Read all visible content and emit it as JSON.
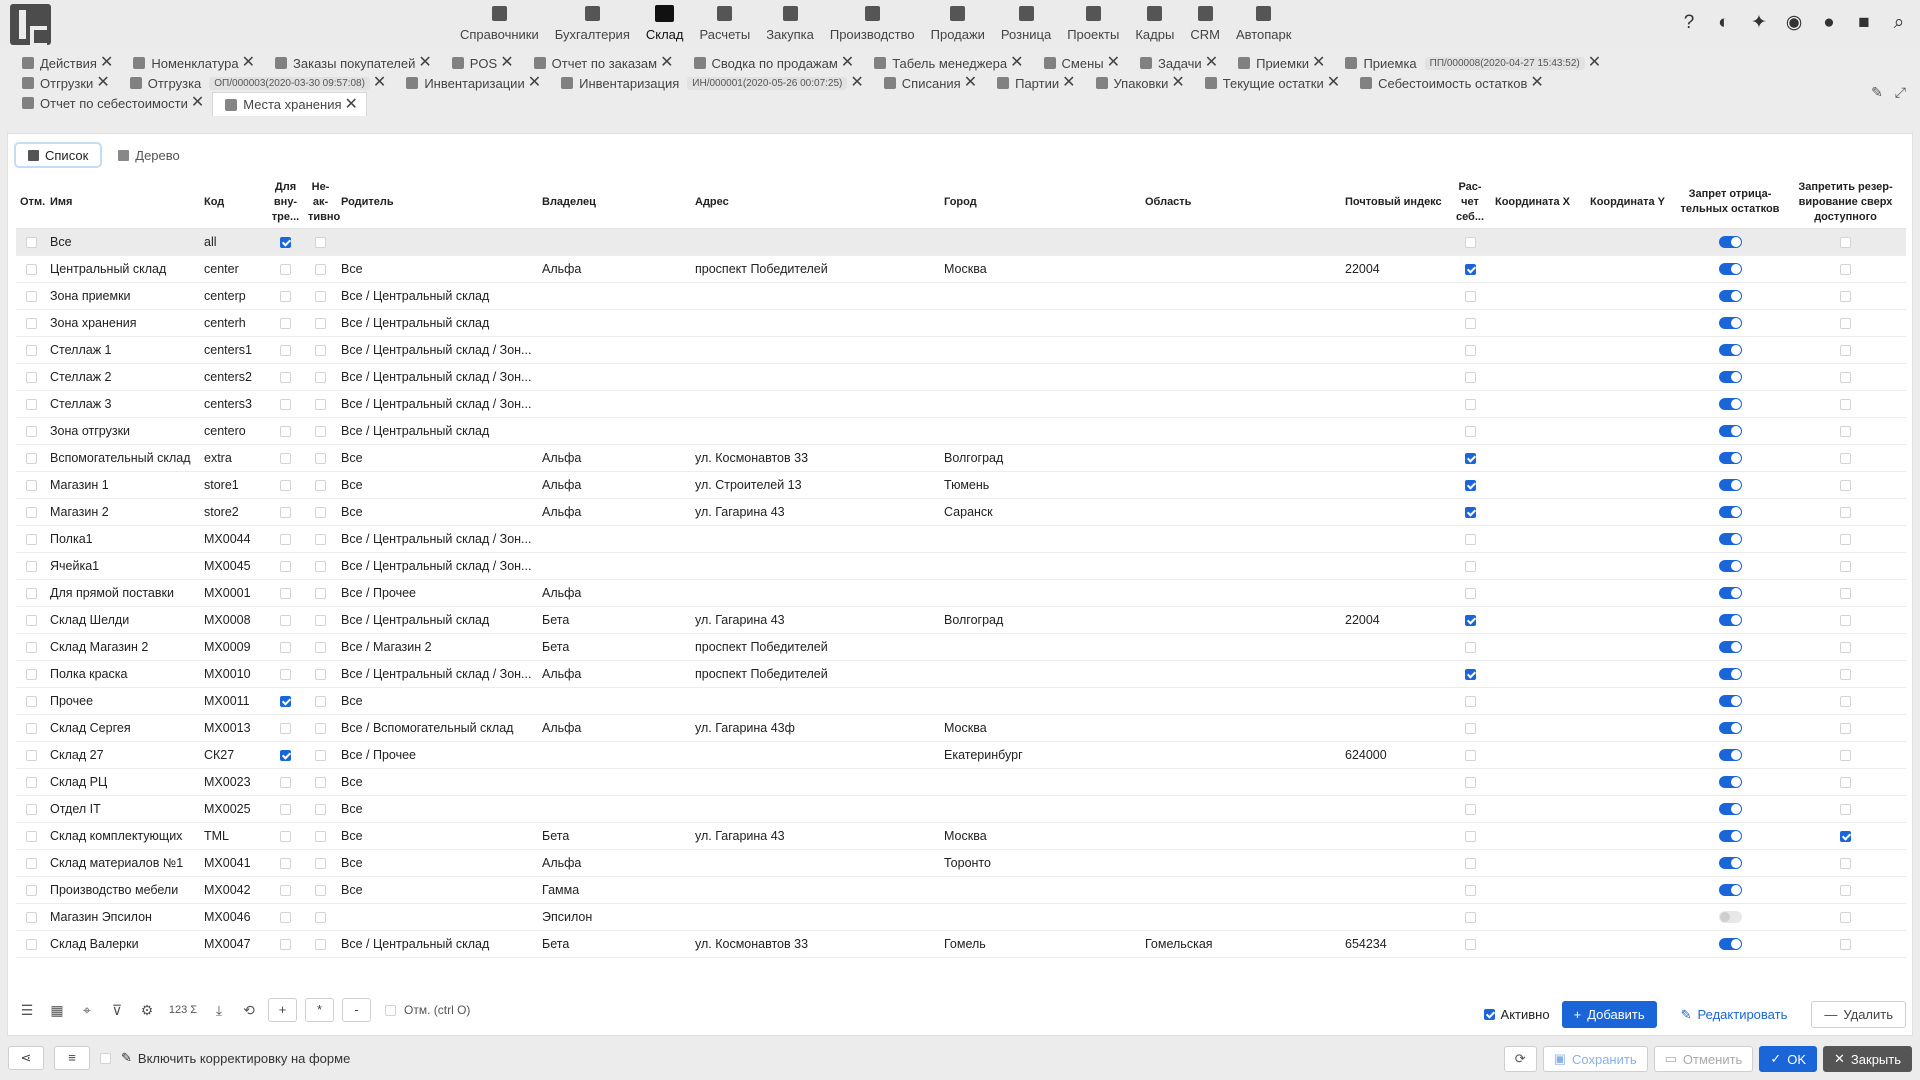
{
  "menu": [
    {
      "label": "Справочники",
      "icon": "list-icon"
    },
    {
      "label": "Бухгалтерия",
      "icon": "ledger-icon"
    },
    {
      "label": "Склад",
      "icon": "warehouse-icon",
      "active": true
    },
    {
      "label": "Расчеты",
      "icon": "money-icon"
    },
    {
      "label": "Закупка",
      "icon": "cart-icon"
    },
    {
      "label": "Производство",
      "icon": "factory-icon"
    },
    {
      "label": "Продажи",
      "icon": "sale-icon"
    },
    {
      "label": "Розница",
      "icon": "bag-icon"
    },
    {
      "label": "Проекты",
      "icon": "project-icon"
    },
    {
      "label": "Кадры",
      "icon": "fingerprint-icon"
    },
    {
      "label": "CRM",
      "icon": "crm-icon"
    },
    {
      "label": "Автопарк",
      "icon": "bus-icon"
    }
  ],
  "top_icons": [
    {
      "name": "help-icon",
      "glyph": "?"
    },
    {
      "name": "contrast-icon",
      "glyph": "◐"
    },
    {
      "name": "pin-icon",
      "glyph": "✦"
    },
    {
      "name": "eye-icon",
      "glyph": "◉"
    },
    {
      "name": "chat-icon",
      "glyph": "●"
    },
    {
      "name": "lock-icon",
      "glyph": "■"
    },
    {
      "name": "search-icon",
      "glyph": "⌕"
    }
  ],
  "tabs_row1": [
    {
      "label": "Действия"
    },
    {
      "label": "Номенклатура"
    },
    {
      "label": "Заказы покупателей"
    },
    {
      "label": "POS"
    },
    {
      "label": "Отчет по заказам"
    },
    {
      "label": "Сводка по продажам"
    },
    {
      "label": "Табель менеджера"
    },
    {
      "label": "Смены"
    },
    {
      "label": "Задачи"
    },
    {
      "label": "Приемки"
    },
    {
      "label": "Приемка",
      "tag": "ПП/000008(2020-04-27 15:43:52)"
    }
  ],
  "tabs_row2": [
    {
      "label": "Отгрузки"
    },
    {
      "label": "Отгрузка",
      "tag": "ОП/000003(2020-03-30 09:57:08)"
    },
    {
      "label": "Инвентаризации"
    },
    {
      "label": "Инвентаризация",
      "tag": "ИН/000001(2020-05-26 00:07:25)"
    },
    {
      "label": "Списания"
    },
    {
      "label": "Партии"
    },
    {
      "label": "Упаковки"
    },
    {
      "label": "Текущие остатки"
    },
    {
      "label": "Себестоимость остатков"
    }
  ],
  "tabs_row3": [
    {
      "label": "Отчет по себестоимости"
    },
    {
      "label": "Места хранения",
      "active": true
    }
  ],
  "view_tabs": {
    "list": "Список",
    "tree": "Дерево"
  },
  "columns": [
    "Отм.",
    "Имя",
    "Код",
    "Для вну-тре...",
    "Не-ак-тивно",
    "Родитель",
    "Владелец",
    "Адрес",
    "Город",
    "Область",
    "Почтовый индекс",
    "Рас-чет себ...",
    "Координата X",
    "Координата Y",
    "Запрет отрица-тельных остатков",
    "Запретить резер-вирование сверх доступного"
  ],
  "rows": [
    {
      "name": "Все",
      "code": "all",
      "internal": true,
      "inactive": false,
      "parent": "",
      "owner": "",
      "address": "",
      "city": "",
      "region": "",
      "zip": "",
      "cost": false,
      "x": "",
      "y": "",
      "neg": true,
      "reserve": false,
      "selected": true
    },
    {
      "name": "Центральный склад",
      "code": "center",
      "internal": false,
      "inactive": false,
      "parent": "Все",
      "owner": "Альфа",
      "address": "проспект Победителей",
      "city": "Москва",
      "region": "",
      "zip": "22004",
      "cost": true,
      "x": "",
      "y": "",
      "neg": true,
      "reserve": false
    },
    {
      "name": "Зона приемки",
      "code": "centerp",
      "internal": false,
      "inactive": false,
      "parent": "Все / Центральный склад",
      "owner": "",
      "address": "",
      "city": "",
      "region": "",
      "zip": "",
      "cost": false,
      "x": "",
      "y": "",
      "neg": true,
      "reserve": false
    },
    {
      "name": "Зона хранения",
      "code": "centerh",
      "internal": false,
      "inactive": false,
      "parent": "Все / Центральный склад",
      "owner": "",
      "address": "",
      "city": "",
      "region": "",
      "zip": "",
      "cost": false,
      "x": "",
      "y": "",
      "neg": true,
      "reserve": false
    },
    {
      "name": "Стеллаж 1",
      "code": "centers1",
      "internal": false,
      "inactive": false,
      "parent": "Все / Центральный склад / Зон...",
      "owner": "",
      "address": "",
      "city": "",
      "region": "",
      "zip": "",
      "cost": false,
      "x": "",
      "y": "",
      "neg": true,
      "reserve": false
    },
    {
      "name": "Стеллаж 2",
      "code": "centers2",
      "internal": false,
      "inactive": false,
      "parent": "Все / Центральный склад / Зон...",
      "owner": "",
      "address": "",
      "city": "",
      "region": "",
      "zip": "",
      "cost": false,
      "x": "",
      "y": "",
      "neg": true,
      "reserve": false
    },
    {
      "name": "Стеллаж 3",
      "code": "centers3",
      "internal": false,
      "inactive": false,
      "parent": "Все / Центральный склад / Зон...",
      "owner": "",
      "address": "",
      "city": "",
      "region": "",
      "zip": "",
      "cost": false,
      "x": "",
      "y": "",
      "neg": true,
      "reserve": false
    },
    {
      "name": "Зона отгрузки",
      "code": "centero",
      "internal": false,
      "inactive": false,
      "parent": "Все / Центральный склад",
      "owner": "",
      "address": "",
      "city": "",
      "region": "",
      "zip": "",
      "cost": false,
      "x": "",
      "y": "",
      "neg": true,
      "reserve": false
    },
    {
      "name": "Вспомогательный склад",
      "code": "extra",
      "internal": false,
      "inactive": false,
      "parent": "Все",
      "owner": "Альфа",
      "address": "ул. Космонавтов 33",
      "city": "Волгоград",
      "region": "",
      "zip": "",
      "cost": true,
      "x": "",
      "y": "",
      "neg": true,
      "reserve": false
    },
    {
      "name": "Магазин 1",
      "code": "store1",
      "internal": false,
      "inactive": false,
      "parent": "Все",
      "owner": "Альфа",
      "address": "ул. Строителей 13",
      "city": "Тюмень",
      "region": "",
      "zip": "",
      "cost": true,
      "x": "",
      "y": "",
      "neg": true,
      "reserve": false
    },
    {
      "name": "Магазин 2",
      "code": "store2",
      "internal": false,
      "inactive": false,
      "parent": "Все",
      "owner": "Альфа",
      "address": "ул. Гагарина 43",
      "city": "Саранск",
      "region": "",
      "zip": "",
      "cost": true,
      "x": "",
      "y": "",
      "neg": true,
      "reserve": false
    },
    {
      "name": "Полка1",
      "code": "MX0044",
      "internal": false,
      "inactive": false,
      "parent": "Все / Центральный склад / Зон...",
      "owner": "",
      "address": "",
      "city": "",
      "region": "",
      "zip": "",
      "cost": false,
      "x": "",
      "y": "",
      "neg": true,
      "reserve": false
    },
    {
      "name": "Ячейка1",
      "code": "MX0045",
      "internal": false,
      "inactive": false,
      "parent": "Все / Центральный склад / Зон...",
      "owner": "",
      "address": "",
      "city": "",
      "region": "",
      "zip": "",
      "cost": false,
      "x": "",
      "y": "",
      "neg": true,
      "reserve": false
    },
    {
      "name": "Для прямой поставки",
      "code": "MX0001",
      "internal": false,
      "inactive": false,
      "parent": "Все / Прочее",
      "owner": "Альфа",
      "address": "",
      "city": "",
      "region": "",
      "zip": "",
      "cost": false,
      "x": "",
      "y": "",
      "neg": true,
      "reserve": false
    },
    {
      "name": "Склад Шелди",
      "code": "MX0008",
      "internal": false,
      "inactive": false,
      "parent": "Все / Центральный склад",
      "owner": "Бета",
      "address": "ул. Гагарина 43",
      "city": "Волгоград",
      "region": "",
      "zip": "22004",
      "cost": true,
      "x": "",
      "y": "",
      "neg": true,
      "reserve": false
    },
    {
      "name": "Склад Магазин 2",
      "code": "MX0009",
      "internal": false,
      "inactive": false,
      "parent": "Все / Магазин 2",
      "owner": "Бета",
      "address": "проспект Победителей",
      "city": "",
      "region": "",
      "zip": "",
      "cost": false,
      "x": "",
      "y": "",
      "neg": true,
      "reserve": false
    },
    {
      "name": "Полка краска",
      "code": "MX0010",
      "internal": false,
      "inactive": false,
      "parent": "Все / Центральный склад / Зон...",
      "owner": "Альфа",
      "address": "проспект Победителей",
      "city": "",
      "region": "",
      "zip": "",
      "cost": true,
      "x": "",
      "y": "",
      "neg": true,
      "reserve": false
    },
    {
      "name": "Прочее",
      "code": "MX0011",
      "internal": true,
      "inactive": false,
      "parent": "Все",
      "owner": "",
      "address": "",
      "city": "",
      "region": "",
      "zip": "",
      "cost": false,
      "x": "",
      "y": "",
      "neg": true,
      "reserve": false
    },
    {
      "name": "Склад Сергея",
      "code": "MX0013",
      "internal": false,
      "inactive": false,
      "parent": "Все / Вспомогательный склад",
      "owner": "Альфа",
      "address": "ул. Гагарина 43ф",
      "city": "Москва",
      "region": "",
      "zip": "",
      "cost": false,
      "x": "",
      "y": "",
      "neg": true,
      "reserve": false
    },
    {
      "name": "Склад 27",
      "code": "СК27",
      "internal": true,
      "inactive": false,
      "parent": "Все / Прочее",
      "owner": "",
      "address": "",
      "city": "Екатеринбург",
      "region": "",
      "zip": "624000",
      "cost": false,
      "x": "",
      "y": "",
      "neg": true,
      "reserve": false
    },
    {
      "name": "Склад РЦ",
      "code": "MX0023",
      "internal": false,
      "inactive": false,
      "parent": "Все",
      "owner": "",
      "address": "",
      "city": "",
      "region": "",
      "zip": "",
      "cost": false,
      "x": "",
      "y": "",
      "neg": true,
      "reserve": false
    },
    {
      "name": "Отдел IT",
      "code": "MX0025",
      "internal": false,
      "inactive": false,
      "parent": "Все",
      "owner": "",
      "address": "",
      "city": "",
      "region": "",
      "zip": "",
      "cost": false,
      "x": "",
      "y": "",
      "neg": true,
      "reserve": false
    },
    {
      "name": "Склад комплектующих",
      "code": "TML",
      "internal": false,
      "inactive": false,
      "parent": "Все",
      "owner": "Бета",
      "address": "ул. Гагарина 43",
      "city": "Москва",
      "region": "",
      "zip": "",
      "cost": false,
      "x": "",
      "y": "",
      "neg": true,
      "reserve": true
    },
    {
      "name": "Склад материалов №1",
      "code": "MX0041",
      "internal": false,
      "inactive": false,
      "parent": "Все",
      "owner": "Альфа",
      "address": "",
      "city": "Торонто",
      "region": "",
      "zip": "",
      "cost": false,
      "x": "",
      "y": "",
      "neg": true,
      "reserve": false
    },
    {
      "name": "Производство мебели",
      "code": "MX0042",
      "internal": false,
      "inactive": false,
      "parent": "Все",
      "owner": "Гамма",
      "address": "",
      "city": "",
      "region": "",
      "zip": "",
      "cost": false,
      "x": "",
      "y": "",
      "neg": true,
      "reserve": false
    },
    {
      "name": "Магазин Эпсилон",
      "code": "MX0046",
      "internal": false,
      "inactive": false,
      "parent": "",
      "owner": "Эпсилон",
      "address": "",
      "city": "",
      "region": "",
      "zip": "",
      "cost": false,
      "x": "",
      "y": "",
      "neg": false,
      "reserve": false
    },
    {
      "name": "Склад Валерки",
      "code": "MX0047",
      "internal": false,
      "inactive": false,
      "parent": "Все / Центральный склад",
      "owner": "Бета",
      "address": "ул. Космонавтов 33",
      "city": "Гомель",
      "region": "Гомельская",
      "zip": "654234",
      "cost": false,
      "x": "",
      "y": "",
      "neg": true,
      "reserve": false
    }
  ],
  "bottom": {
    "mark_label": "Отм. (ctrl O)",
    "active_label": "Активно",
    "add": "Добавить",
    "edit": "Редактировать",
    "delete": "Удалить",
    "num_label": "123",
    "plus": "+",
    "star": "*",
    "minus": "-"
  },
  "footer": {
    "enable_edit": "Включить корректировку на форме",
    "save": "Сохранить",
    "cancel": "Отменить",
    "ok": "OK",
    "close": "Закрыть"
  }
}
